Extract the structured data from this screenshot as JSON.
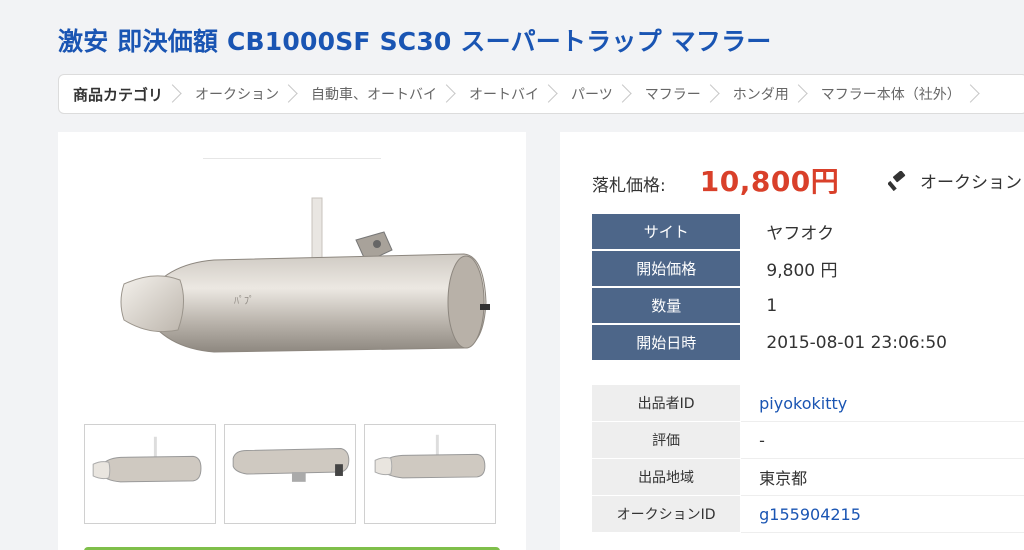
{
  "page": {
    "title": "激安 即決価額 CB1000SF SC30 スーパートラップ マフラー"
  },
  "breadcrumb": {
    "items": [
      "商品カテゴリ",
      "オークション",
      "自動車、オートバイ",
      "オートバイ",
      "パーツ",
      "マフラー",
      "ホンダ用",
      "マフラー本体（社外）"
    ]
  },
  "price": {
    "label": "落札価格:",
    "value": "10,800円",
    "auction_label": "オークション"
  },
  "summary": {
    "rows": [
      {
        "label": "サイト",
        "value": "ヤフオク"
      },
      {
        "label": "開始価格",
        "value": "9,800 円"
      },
      {
        "label": "数量",
        "value": "1"
      },
      {
        "label": "開始日時",
        "value": "2015-08-01 23:06:50"
      }
    ]
  },
  "details": {
    "rows": [
      {
        "label": "出品者ID",
        "value": "piyokokitty"
      },
      {
        "label": "評価",
        "value": "-"
      },
      {
        "label": "出品地域",
        "value": "東京都"
      },
      {
        "label": "オークションID",
        "value": "g155904215"
      }
    ]
  },
  "colors": {
    "title": "#1a55b3",
    "price": "#d9402a",
    "table_header": "#4d6689",
    "button": "#7fbf4a"
  },
  "icons": {
    "auction": "gavel-icon",
    "chevron": "chevron-right-icon"
  }
}
